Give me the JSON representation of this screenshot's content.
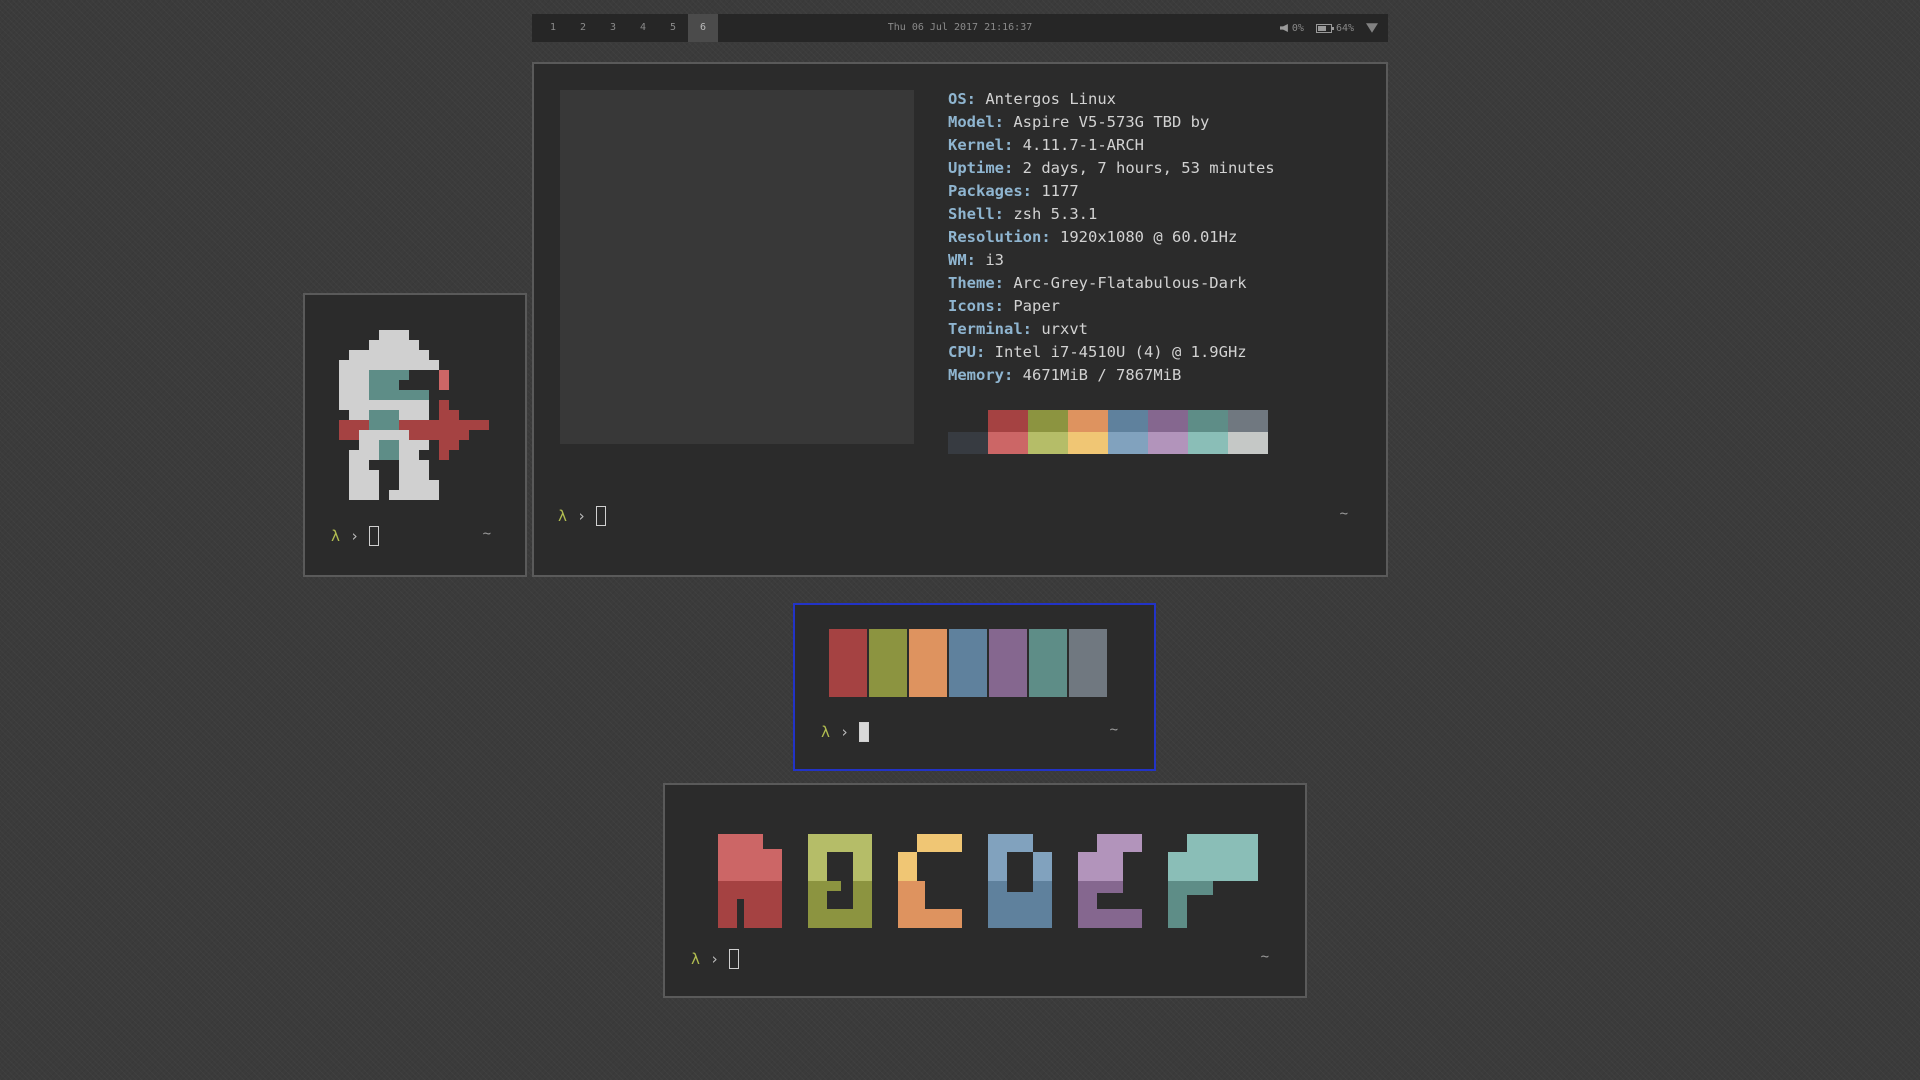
{
  "bar": {
    "workspaces": [
      "1",
      "2",
      "3",
      "4",
      "5",
      "6"
    ],
    "active_workspace": "6",
    "clock": "Thu 06 Jul 2017 21:16:37",
    "volume": "0%",
    "battery": "64%",
    "volume_icon": "speaker-icon",
    "battery_icon": "battery-icon",
    "wifi_icon": "wifi-icon"
  },
  "neofetch": {
    "lines": [
      {
        "key": "OS",
        "value": "Antergos Linux"
      },
      {
        "key": "Model",
        "value": "Aspire V5-573G TBD by"
      },
      {
        "key": "Kernel",
        "value": "4.11.7-1-ARCH"
      },
      {
        "key": "Uptime",
        "value": "2 days, 7 hours, 53 minutes"
      },
      {
        "key": "Packages",
        "value": "1177"
      },
      {
        "key": "Shell",
        "value": "zsh 5.3.1"
      },
      {
        "key": "Resolution",
        "value": "1920x1080 @ 60.01Hz"
      },
      {
        "key": "WM",
        "value": "i3"
      },
      {
        "key": "Theme",
        "value": "Arc-Grey-Flatabulous-Dark"
      },
      {
        "key": "Icons",
        "value": "Paper"
      },
      {
        "key": "Terminal",
        "value": "urxvt"
      },
      {
        "key": "CPU",
        "value": "Intel i7-4510U (4) @ 1.9GHz"
      },
      {
        "key": "Memory",
        "value": "4671MiB / 7867MiB"
      }
    ],
    "palette_normal": [
      "#2b2b2b",
      "#a54242",
      "#8c9440",
      "#de935f",
      "#5f819d",
      "#85678f",
      "#5e8d87",
      "#707880"
    ],
    "palette_bright": [
      "#373b41",
      "#cc6666",
      "#b5bd68",
      "#f0c674",
      "#81a2be",
      "#b294bb",
      "#8abeb7",
      "#c5c8c6"
    ]
  },
  "prompt": {
    "symbol": "λ",
    "arrow": "›",
    "cwd": "~"
  },
  "swatches": [
    "#a54242",
    "#8c9440",
    "#de935f",
    "#5f819d",
    "#85678f",
    "#5e8d87",
    "#707880"
  ],
  "colors": {
    "background": "#3b3b3b",
    "terminal_bg": "#2b2b2b",
    "focused_border": "#2233c7",
    "key_label": "#8fb5d0",
    "prompt_lambda": "#b1bd50"
  }
}
